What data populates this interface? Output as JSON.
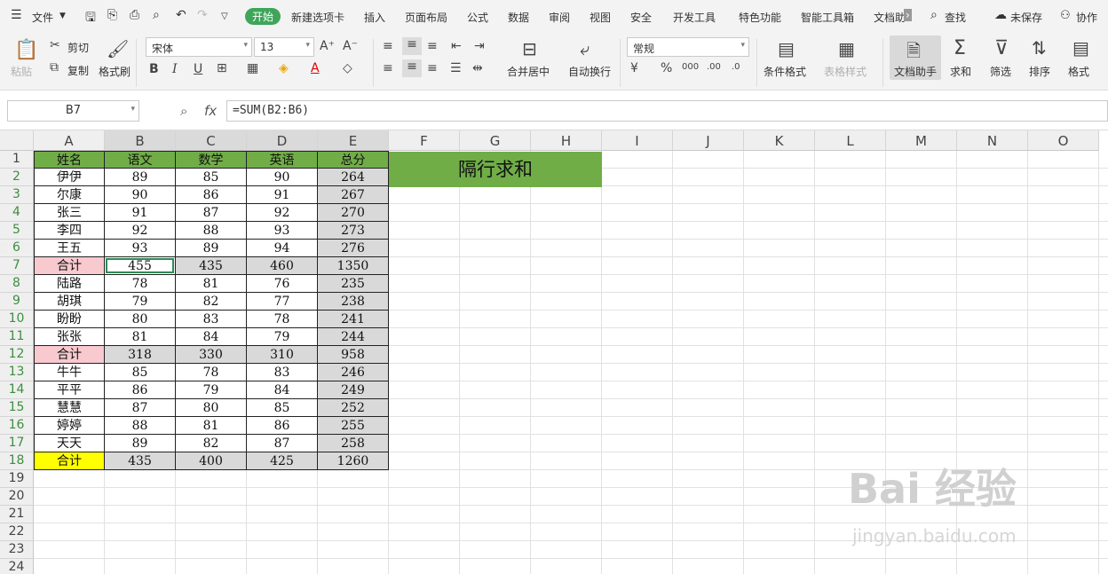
{
  "menu": {
    "file_label": "文件",
    "tabs": [
      "开始",
      "新建选项卡",
      "插入",
      "页面布局",
      "公式",
      "数据",
      "审阅",
      "视图",
      "安全",
      "开发工具",
      "特色功能",
      "智能工具箱",
      "文档助"
    ],
    "search_label": "查找",
    "unsaved_label": "未保存",
    "collab_label": "协作"
  },
  "ribbon": {
    "paste": "粘贴",
    "cut": "剪切",
    "copy": "复制",
    "format_painter": "格式刷",
    "font_name": "宋体",
    "font_size": "13",
    "merge_center": "合并居中",
    "auto_wrap": "自动换行",
    "number_format": "常规",
    "cond_format": "条件格式",
    "table_style": "表格样式",
    "doc_assistant": "文档助手",
    "sum": "求和",
    "filter": "筛选",
    "sort": "排序",
    "format": "格式"
  },
  "formula_bar": {
    "cell_ref": "B7",
    "fx": "fx",
    "formula": "=SUM(B2:B6)"
  },
  "columns": [
    "A",
    "B",
    "C",
    "D",
    "E",
    "F",
    "G",
    "H",
    "I",
    "J",
    "K",
    "L",
    "M",
    "N",
    "O"
  ],
  "rows": [
    "1",
    "2",
    "3",
    "4",
    "5",
    "6",
    "7",
    "8",
    "9",
    "10",
    "11",
    "12",
    "13",
    "14",
    "15",
    "16",
    "17",
    "18",
    "19",
    "20",
    "21",
    "22",
    "23",
    "24"
  ],
  "table": {
    "header": [
      "姓名",
      "语文",
      "数学",
      "英语",
      "总分"
    ],
    "rows": [
      [
        "伊伊",
        "89",
        "85",
        "90",
        "264"
      ],
      [
        "尔康",
        "90",
        "86",
        "91",
        "267"
      ],
      [
        "张三",
        "91",
        "87",
        "92",
        "270"
      ],
      [
        "李四",
        "92",
        "88",
        "93",
        "273"
      ],
      [
        "王五",
        "93",
        "89",
        "94",
        "276"
      ],
      [
        "合计",
        "455",
        "435",
        "460",
        "1350"
      ],
      [
        "陆路",
        "78",
        "81",
        "76",
        "235"
      ],
      [
        "胡琪",
        "79",
        "82",
        "77",
        "238"
      ],
      [
        "盼盼",
        "80",
        "83",
        "78",
        "241"
      ],
      [
        "张张",
        "81",
        "84",
        "79",
        "244"
      ],
      [
        "合计",
        "318",
        "330",
        "310",
        "958"
      ],
      [
        "牛牛",
        "85",
        "78",
        "83",
        "246"
      ],
      [
        "平平",
        "86",
        "79",
        "84",
        "249"
      ],
      [
        "慧慧",
        "87",
        "80",
        "85",
        "252"
      ],
      [
        "婷婷",
        "88",
        "81",
        "86",
        "255"
      ],
      [
        "天天",
        "89",
        "82",
        "87",
        "258"
      ],
      [
        "合计",
        "435",
        "400",
        "425",
        "1260"
      ]
    ]
  },
  "banner_text": "隔行求和",
  "watermark": {
    "main": "Bai 经验",
    "sub": "jingyan.baidu.com"
  },
  "colors": {
    "accent": "#3ea55a",
    "header_fill": "#70ad47",
    "subtotal_fill": "#f8c9cf",
    "total_fill": "#ffff00",
    "sum_fill": "#d9d9d9"
  }
}
